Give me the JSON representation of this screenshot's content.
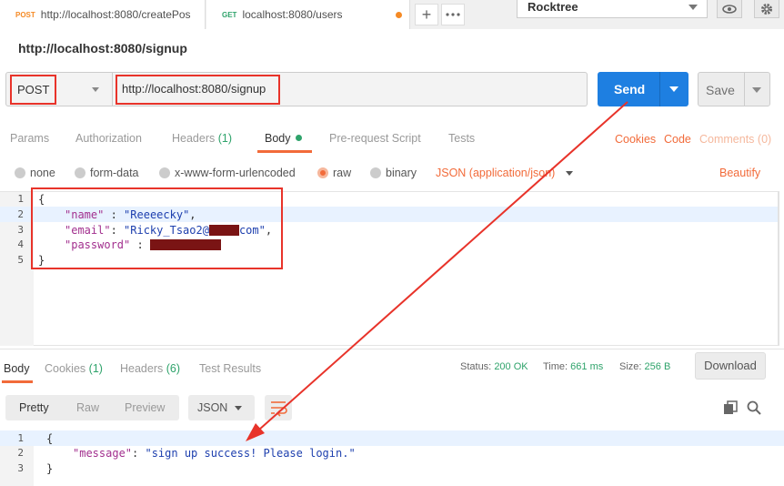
{
  "tabs": [
    {
      "method": "POST",
      "title": "http://localhost:8080/createPos",
      "method_color": "#f58a25"
    },
    {
      "method": "GET",
      "title": "localhost:8080/users",
      "method_color": "#2fa36b"
    }
  ],
  "environment": "Rocktree",
  "request": {
    "title": "http://localhost:8080/signup",
    "method": "POST",
    "url": "http://localhost:8080/signup",
    "send_label": "Send",
    "save_label": "Save"
  },
  "request_tabs": [
    {
      "label": "Params"
    },
    {
      "label": "Authorization"
    },
    {
      "label": "Headers",
      "count": "(1)"
    },
    {
      "label": "Body"
    },
    {
      "label": "Pre-request Script"
    },
    {
      "label": "Tests"
    }
  ],
  "request_links": {
    "cookies": "Cookies",
    "code": "Code",
    "comments": "Comments (0)"
  },
  "body_types": [
    "none",
    "form-data",
    "x-www-form-urlencoded",
    "raw",
    "binary"
  ],
  "selected_body_type": "raw",
  "content_type": "JSON (application/json)",
  "beautify_label": "Beautify",
  "request_body": {
    "line_numbers": [
      "1",
      "2",
      "3",
      "4",
      "5"
    ],
    "open_brace": "{",
    "close_brace": "}",
    "name_key": "\"name\"",
    "name_sep": " : ",
    "name_value": "\"Reeeecky\"",
    "email_key": "\"email\"",
    "email_sep": ": ",
    "email_value_start": "\"Ricky_Tsao2@",
    "email_value_end": "com\"",
    "password_key": "\"password\"",
    "password_sep": " : "
  },
  "response_tabs": [
    {
      "label": "Body"
    },
    {
      "label": "Cookies",
      "count": "(1)"
    },
    {
      "label": "Headers",
      "count": "(6)"
    },
    {
      "label": "Test Results"
    }
  ],
  "response_status": {
    "status_label": "Status:",
    "status_value": "200 OK",
    "time_label": "Time:",
    "time_value": "661 ms",
    "size_label": "Size:",
    "size_value": "256 B"
  },
  "download_label": "Download",
  "view_modes": [
    "Pretty",
    "Raw",
    "Preview"
  ],
  "response_format": "JSON",
  "response_body": {
    "line_numbers": [
      "1",
      "2",
      "3"
    ],
    "open_brace": "{",
    "close_brace": "}",
    "message_key": "\"message\"",
    "message_sep": ": ",
    "message_value": "\"sign up success! Please login.\""
  },
  "colors": {
    "accent": "#f26b3a",
    "send": "#1e7fe1",
    "success": "#2fa36b",
    "annotation": "#e8332a"
  }
}
